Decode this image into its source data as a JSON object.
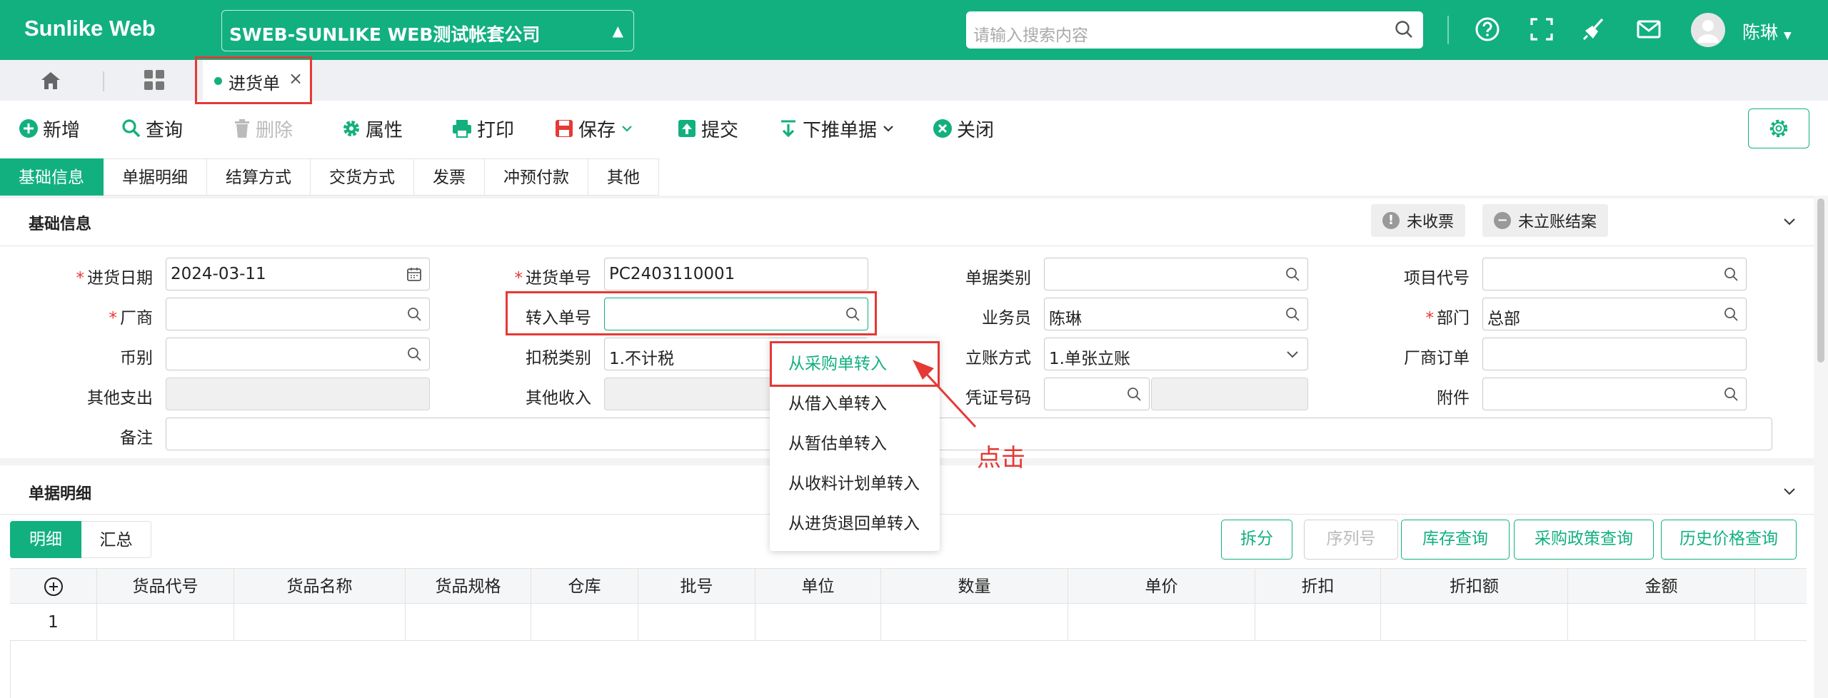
{
  "app": {
    "title": "Sunlike Web",
    "company": "SWEB-SUNLIKE WEB测试帐套公司",
    "search_placeholder": "请输入搜索内容",
    "user": "陈琳",
    "accent": "#12b07f",
    "highlight": "#e53935"
  },
  "tabs": {
    "doc_tab": "进货单"
  },
  "toolbar": {
    "add": "新增",
    "query": "查询",
    "delete": "删除",
    "properties": "属性",
    "print": "打印",
    "save": "保存",
    "submit": "提交",
    "push_down": "下推单据",
    "close": "关闭"
  },
  "section_tabs": [
    "基础信息",
    "单据明细",
    "结算方式",
    "交货方式",
    "发票",
    "冲预付款",
    "其他"
  ],
  "basic": {
    "title": "基础信息",
    "badge_invoice": "未收票",
    "badge_account": "未立账结案",
    "labels": {
      "date": "进货日期",
      "vendor": "厂商",
      "currency": "币别",
      "other_expense": "其他支出",
      "remark": "备注",
      "doc_no": "进货单号",
      "transfer_no": "转入单号",
      "tax_type": "扣税类别",
      "other_income": "其他收入",
      "doc_category": "单据类别",
      "salesperson": "业务员",
      "account_method": "立账方式",
      "voucher_no": "凭证号码",
      "project_code": "项目代号",
      "department": "部门",
      "vendor_order": "厂商订单",
      "attachment": "附件"
    },
    "values": {
      "date": "2024-03-11",
      "doc_no": "PC2403110001",
      "tax_type": "1.不计税",
      "salesperson": "陈琳",
      "account_method": "1.单张立账",
      "department": "总部"
    }
  },
  "dropdown": {
    "items": [
      "从采购单转入",
      "从借入单转入",
      "从暂估单转入",
      "从收料计划单转入",
      "从进货退回单转入"
    ],
    "hint": "点击"
  },
  "detail": {
    "title": "单据明细",
    "subtabs": [
      "明细",
      "汇总"
    ],
    "buttons": {
      "split": "拆分",
      "serial": "序列号",
      "stock_query": "库存查询",
      "purchase_policy": "采购政策查询",
      "price_history": "历史价格查询"
    },
    "columns": [
      "货品代号",
      "货品名称",
      "货品规格",
      "仓库",
      "批号",
      "单位",
      "数量",
      "单价",
      "折扣",
      "折扣额",
      "金额"
    ],
    "rows": [
      {
        "no": "1"
      }
    ]
  }
}
